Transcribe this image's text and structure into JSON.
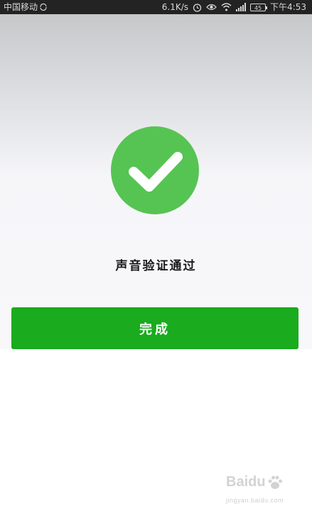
{
  "status_bar": {
    "carrier": "中国移动",
    "network_speed": "6.1K/s",
    "battery_level": "45",
    "time": "下午4:53"
  },
  "main": {
    "result_text": "声音验证通过",
    "done_button_label": "完成"
  },
  "watermark": {
    "brand": "Baidu",
    "sub": "jingyan.baidu.com"
  },
  "colors": {
    "success_green": "#56c452",
    "button_green": "#1aab1e",
    "status_bar_bg": "#232323"
  },
  "icons": {
    "status": [
      "alarm-icon",
      "eye-icon",
      "wifi-icon",
      "signal-icon",
      "battery-icon"
    ],
    "main": "checkmark-icon"
  }
}
